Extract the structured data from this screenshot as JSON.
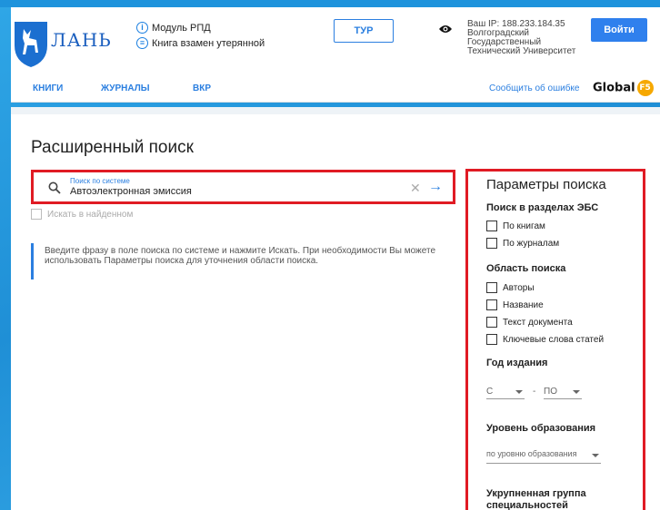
{
  "header": {
    "logo_text": "ЛАНЬ",
    "module_link": "Модуль РПД",
    "lost_book_link": "Книга взамен утерянной",
    "tur_button": "ТУР",
    "ip_text": "Ваш IP: 188.233.184.35",
    "org_line1": "Волгоградский",
    "org_line2": "Государственный",
    "org_line3": "Технический Университет",
    "login_button": "Войти"
  },
  "nav": {
    "items": [
      {
        "label": "КНИГИ"
      },
      {
        "label": "ЖУРНАЛЫ"
      },
      {
        "label": "ВКР"
      }
    ],
    "report_error": "Сообщить об ошибке",
    "global_label": "Global",
    "global_badge": "F5"
  },
  "main": {
    "title": "Расширенный поиск",
    "search": {
      "label": "Поиск по системе",
      "value": "Автоэлектронная эмиссия"
    },
    "search_in_found": "Искать в найденном",
    "hint": "Введите фразу в поле поиска по системе и нажмите Искать. При необходимости Вы можете использовать Параметры поиска для уточнения области поиска."
  },
  "params": {
    "title": "Параметры поиска",
    "ebs_section": "Поиск в разделах ЭБС",
    "ebs_options": [
      "По книгам",
      "По журналам"
    ],
    "area_section": "Область поиска",
    "area_options": [
      "Авторы",
      "Название",
      "Текст документа",
      "Ключевые слова статей"
    ],
    "year_section": "Год издания",
    "year_from": "С",
    "year_sep": "-",
    "year_to": "ПО",
    "level_section": "Уровень образования",
    "level_select": "по уровню образования",
    "group_section_line1": "Укрупненная группа",
    "group_section_line2": "специальностей"
  },
  "colors": {
    "accent": "#2b7fe0",
    "highlight": "#e01b24",
    "background": "#2a9ee0"
  }
}
